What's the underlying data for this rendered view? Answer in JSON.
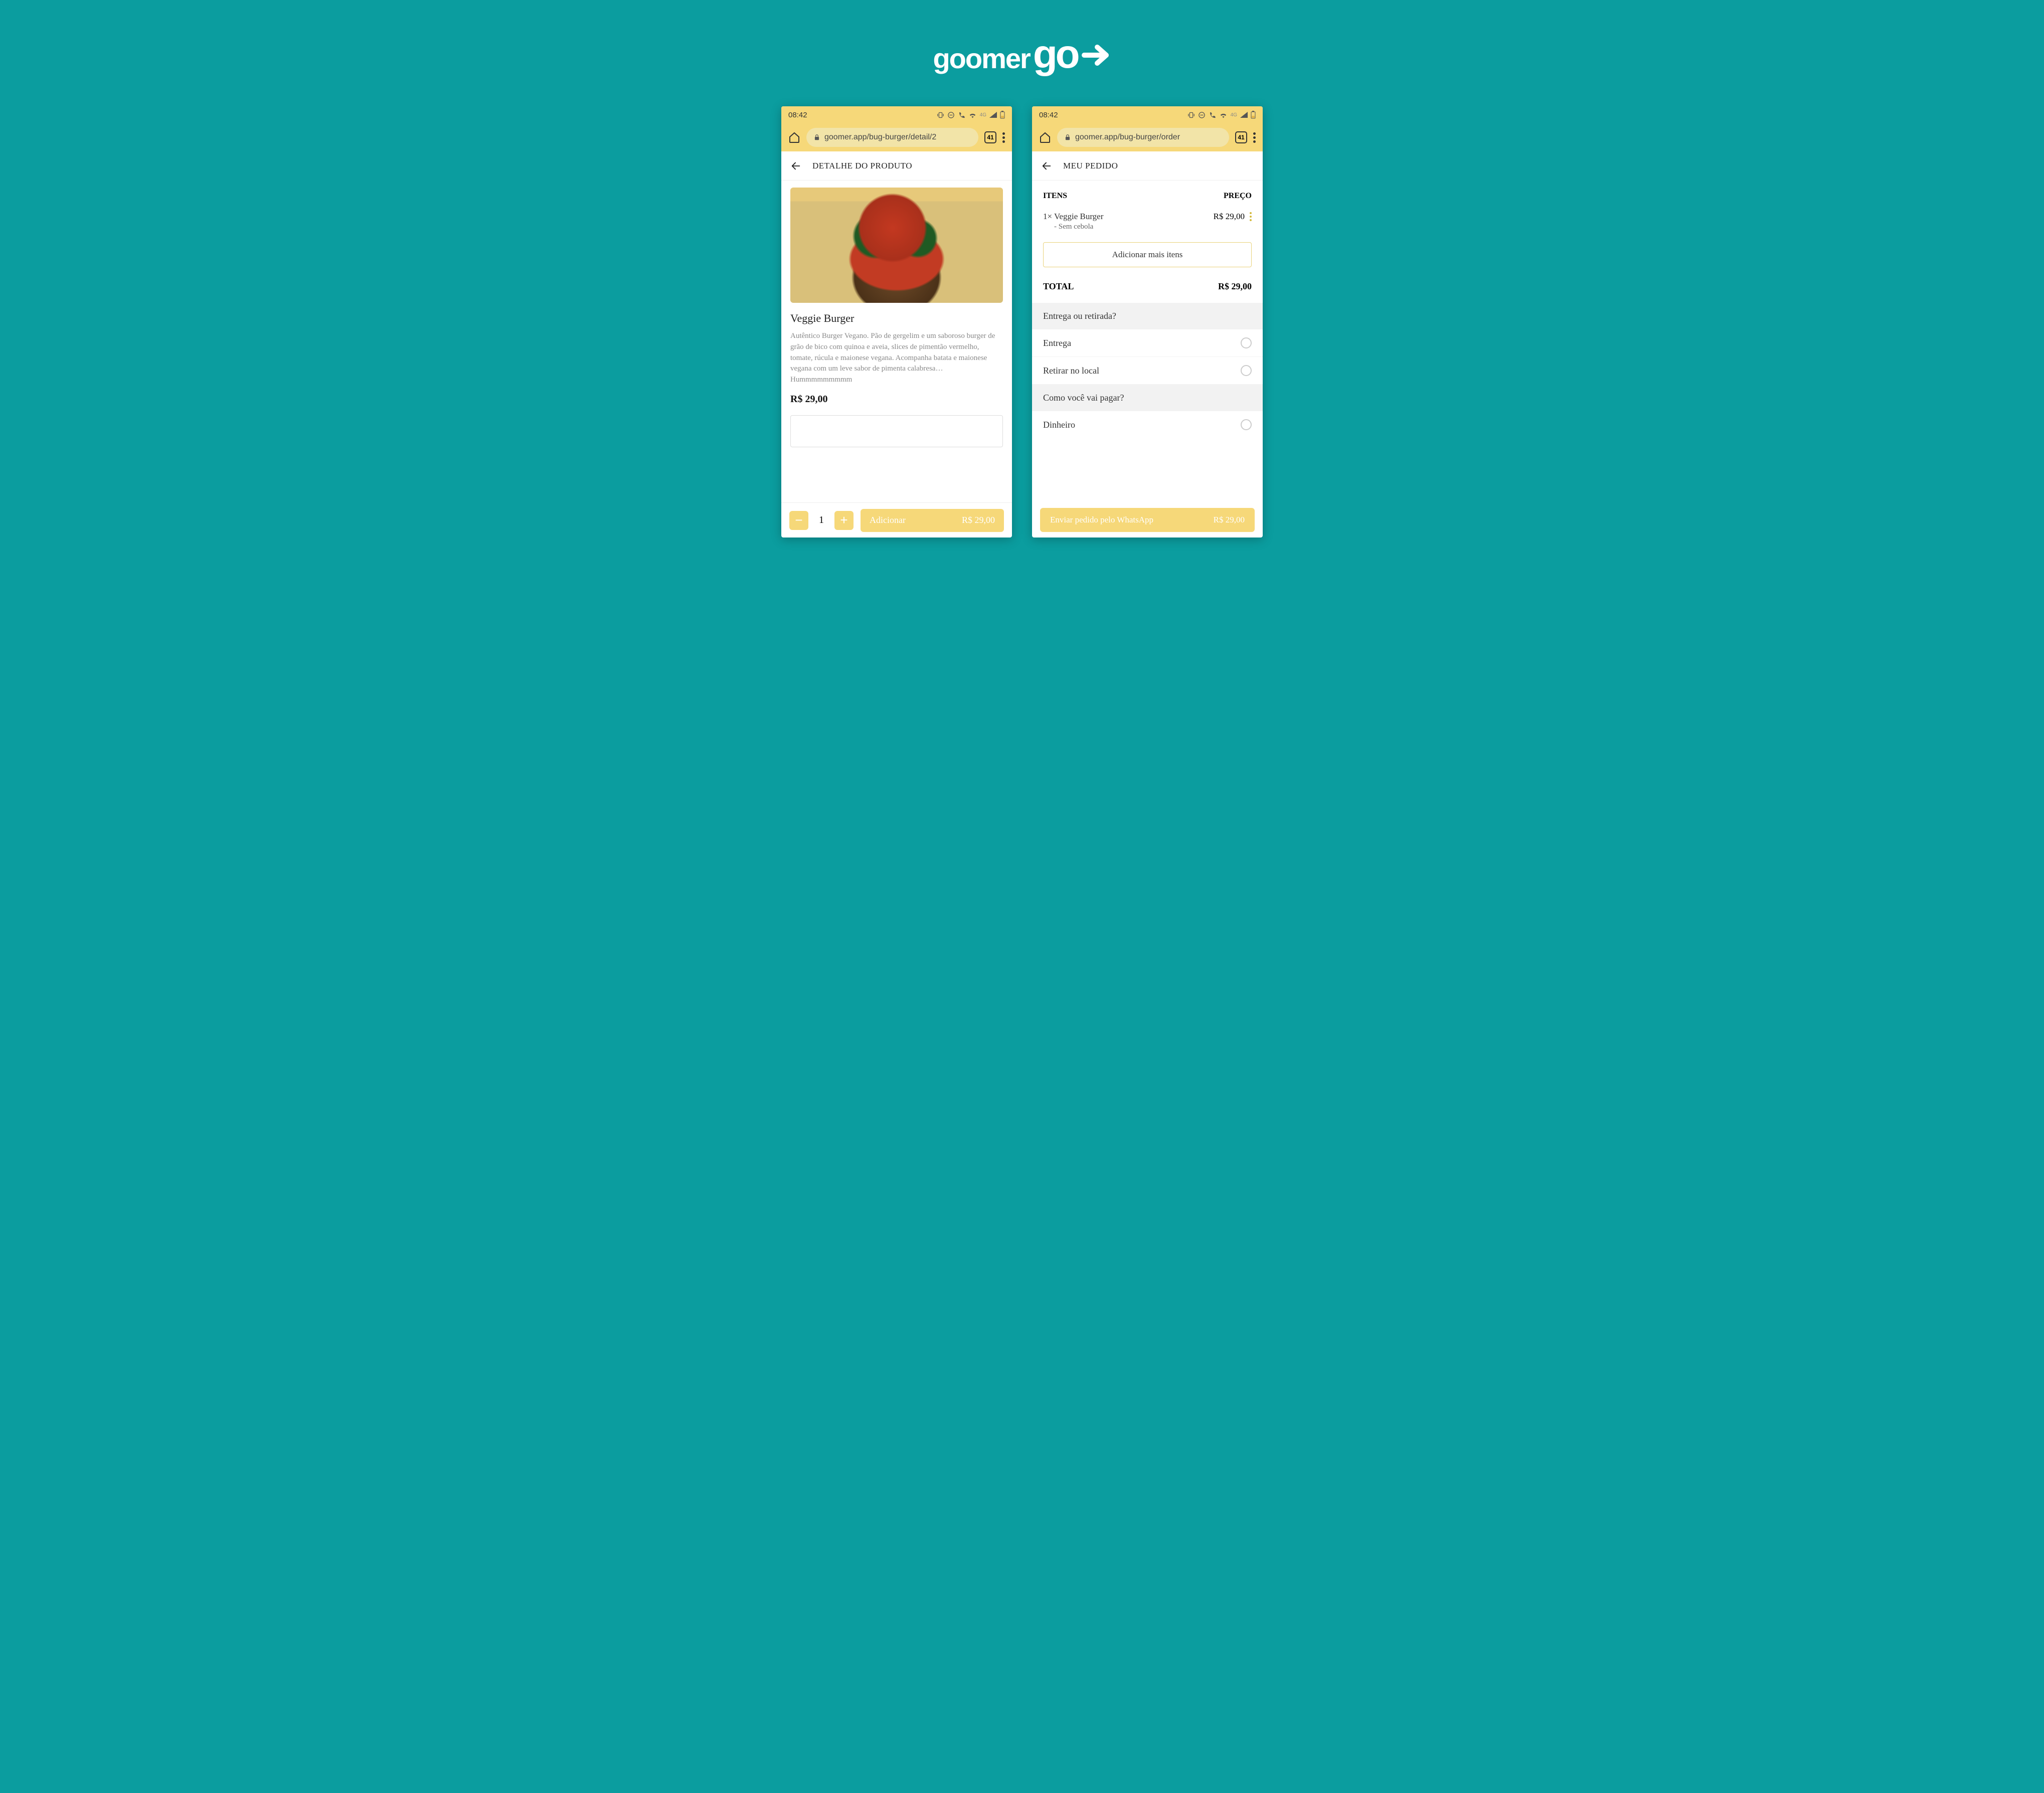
{
  "logo": {
    "part1": "goomer",
    "part2": "go"
  },
  "status": {
    "time": "08:42",
    "net_label": "4G",
    "tabs": "41"
  },
  "left": {
    "url": "goomer.app/bug-burger/detail/2",
    "header": "DETALHE DO PRODUTO",
    "product": {
      "name": "Veggie Burger",
      "description": "Autêntico Burger Vegano. Pão de gergelim e um saboroso burger de grão de bico com quinoa e aveia, slices de pimentão vermelho, tomate, rúcula e maionese vegana. Acompanha batata e maionese vegana com um leve sabor de pimenta calabresa… Hummmmmmmmm",
      "price": "R$ 29,00"
    },
    "qty": "1",
    "add_label": "Adicionar",
    "add_price": "R$ 29,00"
  },
  "right": {
    "url": "goomer.app/bug-burger/order",
    "header": "MEU PEDIDO",
    "columns": {
      "items": "ITENS",
      "price": "PREÇO"
    },
    "item": {
      "line": "1× Veggie Burger",
      "mod": "- Sem cebola",
      "price": "R$ 29,00"
    },
    "add_more": "Adicionar mais itens",
    "total_label": "TOTAL",
    "total_value": "R$ 29,00",
    "delivery_q": "Entrega ou retirada?",
    "delivery_opts": {
      "a": "Entrega",
      "b": "Retirar no local"
    },
    "pay_q": "Como você vai pagar?",
    "pay_opts": {
      "a": "Dinheiro"
    },
    "send_label": "Enviar pedido pelo WhatsApp",
    "send_price": "R$ 29,00"
  }
}
